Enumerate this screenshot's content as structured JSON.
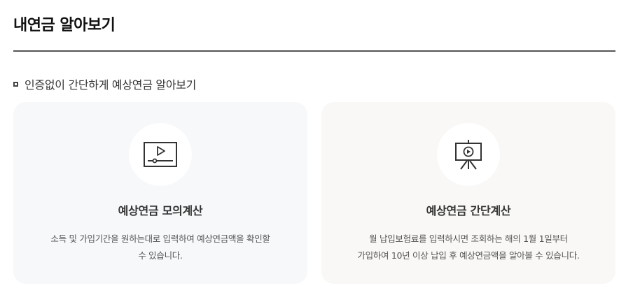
{
  "page": {
    "title": "내연금 알아보기"
  },
  "section": {
    "heading": "인증없이 간단하게 예상연금 알아보기"
  },
  "cards": [
    {
      "icon": "video-play-icon",
      "title": "예상연금 모의계산",
      "desc_line1": "소득 및 가입기간을 원하는대로 입력하여 예상연금액을 확인할",
      "desc_line2": "수 있습니다."
    },
    {
      "icon": "presentation-board-icon",
      "title": "예상연금 간단계산",
      "desc_line1": "월 납입보험료를 입력하시면 조회하는 해의 1월 1일부터",
      "desc_line2": "가입하여 10년 이상 납입 후 예상연금액을 알아볼 수 있습니다."
    }
  ]
}
